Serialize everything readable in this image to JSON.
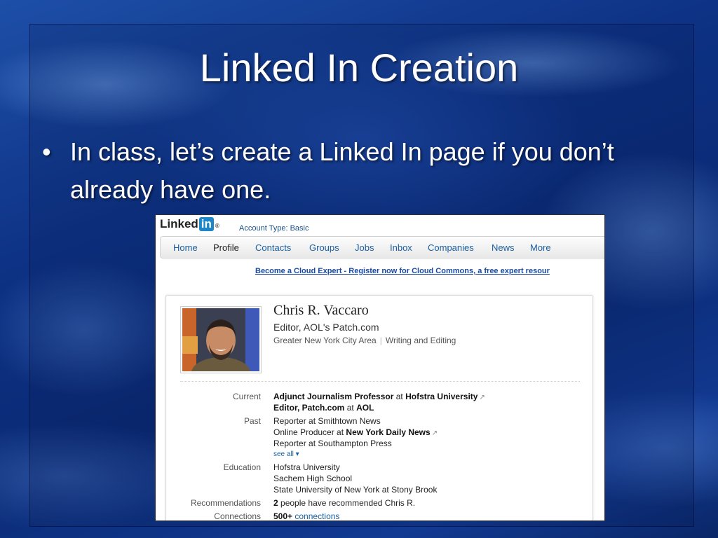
{
  "slide": {
    "title": "Linked In Creation",
    "bullet": "In class, let’s create a Linked In page if you don’t already have one."
  },
  "linkedin": {
    "logo_text": "Linked",
    "logo_in": "in",
    "logo_reg": "®",
    "account_type": "Account Type: Basic",
    "nav": [
      "Home",
      "Profile",
      "Contacts",
      "Groups",
      "Jobs",
      "Inbox",
      "Companies",
      "News",
      "More"
    ],
    "promo": "Become a Cloud Expert - Register now for Cloud Commons, a free expert resour",
    "profile": {
      "name": "Chris R. Vaccaro",
      "headline": "Editor, AOL's Patch.com",
      "location": "Greater New York City Area",
      "industry": "Writing and Editing"
    },
    "rows": {
      "current_label": "Current",
      "current_1_title": "Adjunct Journalism Professor",
      "current_1_at": "at",
      "current_1_org": "Hofstra University",
      "current_2_title": "Editor, Patch.com",
      "current_2_at": "at",
      "current_2_org": "AOL",
      "past_label": "Past",
      "past_1": "Reporter at Smithtown News",
      "past_2_title": "Online Producer at",
      "past_2_org": "New York Daily News",
      "past_3": "Reporter at Southampton Press",
      "see_all": "see all ▾",
      "education_label": "Education",
      "edu_1": "Hofstra University",
      "edu_2": "Sachem High School",
      "edu_3": "State University of New York at Stony Brook",
      "rec_label": "Recommendations",
      "rec_count": "2",
      "rec_text": "people have recommended Chris R.",
      "conn_label": "Connections",
      "conn_count": "500+",
      "conn_text": "connections"
    },
    "external_icon": "external-link-icon"
  },
  "colors": {
    "slide_bg": "#0b2a6a",
    "linkedin_blue": "#1d86c8",
    "link_blue": "#1a5fa0"
  }
}
